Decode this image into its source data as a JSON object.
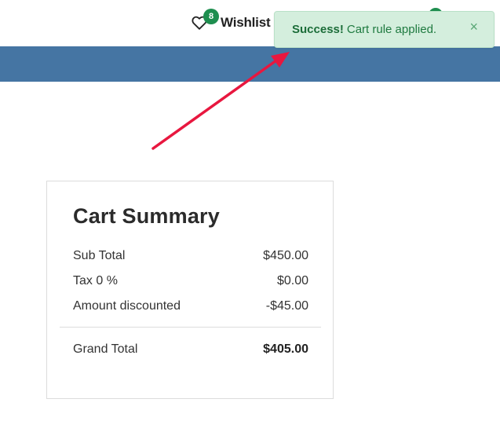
{
  "header": {
    "wishlist": {
      "label": "Wishlist",
      "count": "8",
      "icon": "heart-icon"
    },
    "nav_color": "#4575a3"
  },
  "alert": {
    "title": "Success!",
    "message": "Cart rule applied.",
    "close": "×",
    "color": "#d4eedd"
  },
  "annotation": {
    "arrow_color": "#e8173f"
  },
  "cart_summary": {
    "title": "Cart Summary",
    "rows": [
      {
        "label": "Sub Total",
        "value": "$450.00"
      },
      {
        "label": "Tax 0 %",
        "value": "$0.00"
      },
      {
        "label": "Amount discounted",
        "value": "-$45.00"
      }
    ],
    "grand_total": {
      "label": "Grand Total",
      "value": "$405.00"
    }
  }
}
